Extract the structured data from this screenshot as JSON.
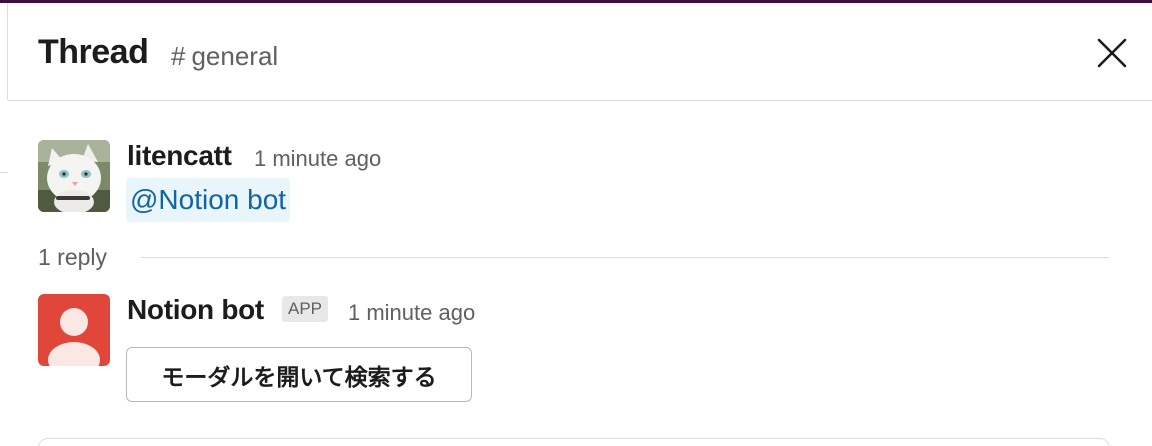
{
  "header": {
    "title": "Thread",
    "channel_hash": "#",
    "channel_name": "general",
    "close_icon": "close-icon"
  },
  "thread": {
    "parent": {
      "author": "litencatt",
      "timestamp": "1 minute ago",
      "mention": "@Notion bot",
      "avatar_icon": "cat-avatar"
    },
    "reply_count": "1 reply",
    "replies": [
      {
        "author": "Notion bot",
        "badge": "APP",
        "timestamp": "1 minute ago",
        "avatar_icon": "user-avatar",
        "button_label": "モーダルを開いて検索する"
      }
    ]
  },
  "colors": {
    "sidebar_strip": "#3f0e40",
    "mention_text": "#1264a3",
    "mention_bg": "#e8f5fa",
    "bot_avatar": "#e0473a"
  }
}
